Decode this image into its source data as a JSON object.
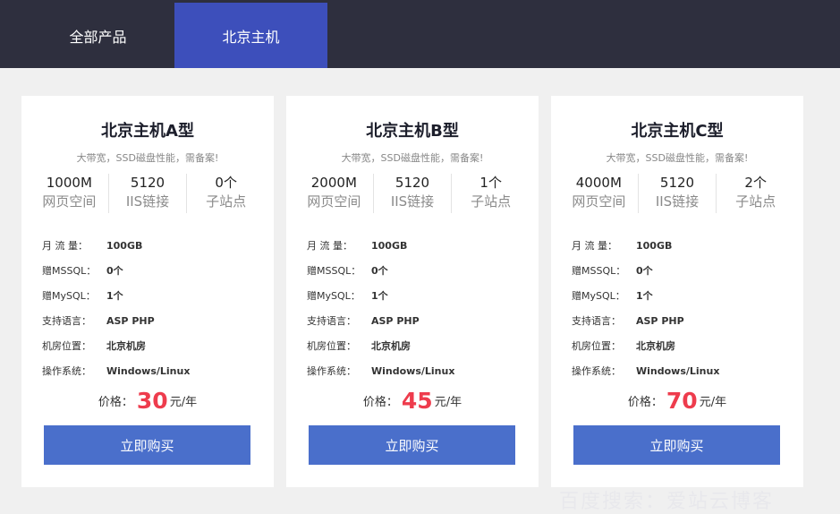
{
  "tabs": [
    {
      "label": "全部产品"
    },
    {
      "label": "北京主机"
    }
  ],
  "cards": [
    {
      "title": "北京主机A型",
      "subtitle": "大带宽，SSD磁盘性能，需备案!",
      "stats": [
        {
          "value": "1000M",
          "label": "网页空间"
        },
        {
          "value": "5120",
          "label": "IIS链接"
        },
        {
          "value": "0个",
          "label": "子站点"
        }
      ],
      "specs": [
        {
          "label": "月 流 量：",
          "value": "100GB"
        },
        {
          "label": "赠MSSQL：",
          "value": "0个"
        },
        {
          "label": "赠MySQL：",
          "value": "1个"
        },
        {
          "label": "支持语言：",
          "value": "ASP PHP"
        },
        {
          "label": "机房位置：",
          "value": "北京机房"
        },
        {
          "label": "操作系统：",
          "value": "Windows/Linux"
        }
      ],
      "price_label": "价格：",
      "price": "30",
      "price_unit": "元/年",
      "buy_label": "立即购买"
    },
    {
      "title": "北京主机B型",
      "subtitle": "大带宽，SSD磁盘性能，需备案!",
      "stats": [
        {
          "value": "2000M",
          "label": "网页空间"
        },
        {
          "value": "5120",
          "label": "IIS链接"
        },
        {
          "value": "1个",
          "label": "子站点"
        }
      ],
      "specs": [
        {
          "label": "月 流 量：",
          "value": "100GB"
        },
        {
          "label": "赠MSSQL：",
          "value": "0个"
        },
        {
          "label": "赠MySQL：",
          "value": "1个"
        },
        {
          "label": "支持语言：",
          "value": "ASP PHP"
        },
        {
          "label": "机房位置：",
          "value": "北京机房"
        },
        {
          "label": "操作系统：",
          "value": "Windows/Linux"
        }
      ],
      "price_label": "价格：",
      "price": "45",
      "price_unit": "元/年",
      "buy_label": "立即购买"
    },
    {
      "title": "北京主机C型",
      "subtitle": "大带宽，SSD磁盘性能，需备案!",
      "stats": [
        {
          "value": "4000M",
          "label": "网页空间"
        },
        {
          "value": "5120",
          "label": "IIS链接"
        },
        {
          "value": "2个",
          "label": "子站点"
        }
      ],
      "specs": [
        {
          "label": "月 流 量：",
          "value": "100GB"
        },
        {
          "label": "赠MSSQL：",
          "value": "0个"
        },
        {
          "label": "赠MySQL：",
          "value": "1个"
        },
        {
          "label": "支持语言：",
          "value": "ASP PHP"
        },
        {
          "label": "机房位置：",
          "value": "北京机房"
        },
        {
          "label": "操作系统：",
          "value": "Windows/Linux"
        }
      ],
      "price_label": "价格：",
      "price": "70",
      "price_unit": "元/年",
      "buy_label": "立即购买"
    }
  ],
  "watermark": "百度搜索：爱站云博客",
  "colors": {
    "topbar": "#2e2f3e",
    "active_tab": "#3d4fbb",
    "button": "#4a6fcb",
    "price": "#ee3c4d",
    "page_background": "#f0f0f0"
  }
}
